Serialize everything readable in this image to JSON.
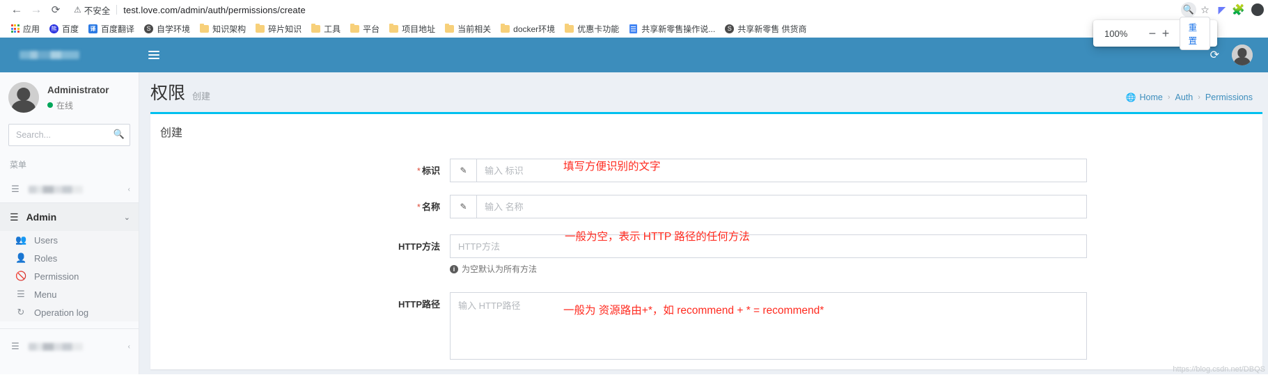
{
  "browser": {
    "back_icon": "back-arrow-icon",
    "forward_icon": "forward-arrow-icon",
    "reload_icon": "reload-icon",
    "security_label": "不安全",
    "url": "test.love.com/admin/auth/permissions/create",
    "zoom_indicator_icon": "zoom-magnifier-icon",
    "bookmark_star_icon": "star-icon",
    "bookmarks": [
      {
        "label": "应用",
        "icon": "apps-grid-icon"
      },
      {
        "label": "百度",
        "icon": "baidu-icon"
      },
      {
        "label": "百度翻译",
        "icon": "translate-icon"
      },
      {
        "label": "自学环境",
        "icon": "globe-icon"
      },
      {
        "label": "知识架构",
        "icon": "folder-icon"
      },
      {
        "label": "碎片知识",
        "icon": "folder-icon"
      },
      {
        "label": "工具",
        "icon": "folder-icon"
      },
      {
        "label": "平台",
        "icon": "folder-icon"
      },
      {
        "label": "项目地址",
        "icon": "folder-icon"
      },
      {
        "label": "当前相关",
        "icon": "folder-icon"
      },
      {
        "label": "docker环境",
        "icon": "folder-icon"
      },
      {
        "label": "优惠卡功能",
        "icon": "folder-icon"
      },
      {
        "label": "共享新零售操作说...",
        "icon": "document-icon"
      },
      {
        "label": "共享新零售 供货商",
        "icon": "globe-icon"
      }
    ],
    "zoom_popup": {
      "percent": "100%",
      "minus_label": "−",
      "plus_label": "+",
      "reset_label": "重置"
    }
  },
  "topbar": {
    "menu_toggle_icon": "hamburger-icon",
    "sync_icon": "refresh-sync-icon",
    "avatar_icon": "user-avatar"
  },
  "sidebar": {
    "user": {
      "name": "Administrator",
      "status": "在线"
    },
    "search": {
      "placeholder": "Search...",
      "button_icon": "search-icon"
    },
    "menu_header": "菜单",
    "top_item": {
      "icon": "bars-icon",
      "label": "",
      "chevron": "‹"
    },
    "section": {
      "icon": "server-icon",
      "label": "Admin",
      "chevron": "⌄"
    },
    "items": [
      {
        "label": "Users",
        "icon": "users-icon"
      },
      {
        "label": "Roles",
        "icon": "user-icon"
      },
      {
        "label": "Permission",
        "icon": "ban-icon"
      },
      {
        "label": "Menu",
        "icon": "bars-icon"
      },
      {
        "label": "Operation log",
        "icon": "history-icon"
      }
    ],
    "bottom_item": {
      "icon": "bars-icon",
      "label": "",
      "chevron": "‹"
    }
  },
  "page": {
    "title": "权限",
    "subtitle": "创建",
    "breadcrumb": [
      {
        "label": "Home",
        "icon": "globe-icon"
      },
      {
        "label": "Auth"
      },
      {
        "label": "Permissions"
      }
    ],
    "breadcrumb_separator": "›"
  },
  "form": {
    "box_title": "创建",
    "fields": [
      {
        "label": "标识",
        "required": true,
        "addon_icon": "pencil-icon",
        "placeholder": "输入 标识",
        "value": "",
        "type": "input-group"
      },
      {
        "label": "名称",
        "required": true,
        "addon_icon": "pencil-icon",
        "placeholder": "输入 名称",
        "value": "",
        "type": "input-group"
      },
      {
        "label": "HTTP方法",
        "required": false,
        "placeholder": "HTTP方法",
        "value": "",
        "type": "input",
        "help": "为空默认为所有方法",
        "help_icon": "info-circle-icon"
      },
      {
        "label": "HTTP路径",
        "required": false,
        "placeholder": "输入 HTTP路径",
        "value": "",
        "type": "textarea"
      }
    ]
  },
  "annotations": [
    {
      "text": "填写方便识别的文字",
      "color": "#ff2a1f"
    },
    {
      "text": "一般为空，表示 HTTP 路径的任何方法",
      "color": "#ff2a1f"
    },
    {
      "text": "一般为 资源路由+*，如 recommend + * = recommend*",
      "color": "#ff2a1f"
    }
  ],
  "watermark": "https://blog.csdn.net/DBQS",
  "colors": {
    "brand_blue": "#3c8dbc",
    "accent_cyan": "#00c0ef",
    "required_red": "#dd4b39",
    "annotation_red": "#ff2a1f",
    "link_blue": "#1a73e8"
  }
}
